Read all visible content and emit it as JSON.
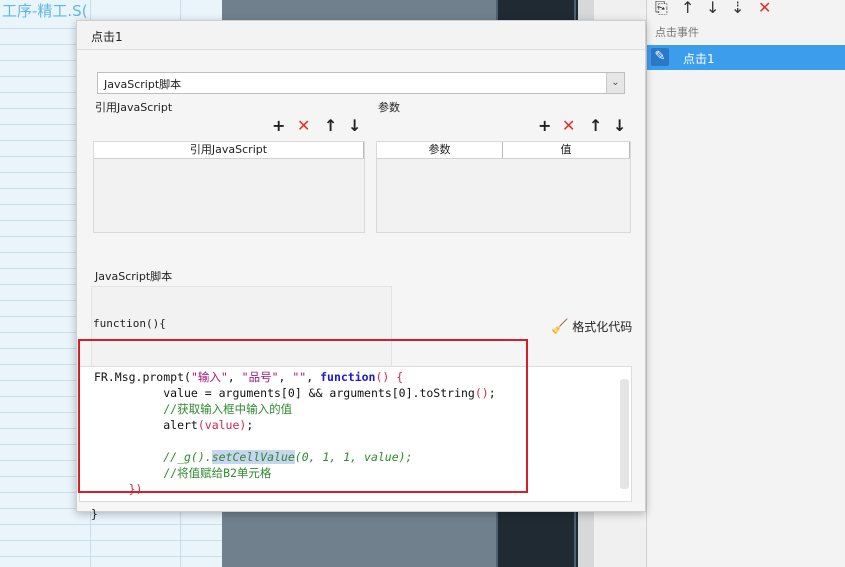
{
  "background": {
    "sheet_title": "工序-精工.S("
  },
  "right_panel": {
    "toolbar_icons": [
      "copy-icon",
      "arrow-up-icon",
      "arrow-down-icon",
      "sort-down-icon",
      "close-icon"
    ],
    "events_title": "点击事件",
    "events": [
      {
        "label": "点击1",
        "selected": true
      }
    ]
  },
  "dialog": {
    "title": "点击1",
    "type_select": {
      "value": "JavaScript脚本"
    },
    "ref_js": {
      "label": "引用JavaScript",
      "column": "引用JavaScript"
    },
    "params": {
      "label": "参数",
      "columns": [
        "参数",
        "值"
      ]
    },
    "script": {
      "label": "JavaScript脚本",
      "header": "function(){",
      "format_button": "格式化代码",
      "code": {
        "l1": [
          "FR.Msg.prompt(",
          "\"输入\"",
          ", ",
          "\"品号\"",
          ", ",
          "\"\"",
          ", ",
          "function",
          "() {"
        ],
        "l2": [
          "          value = arguments[",
          "0",
          "] && arguments[",
          "0",
          "].toString",
          "()",
          ";"
        ],
        "l3": "          //获取输入框中输入的值",
        "l4": [
          "          alert",
          "(value)",
          ";"
        ],
        "l6": [
          "          //_g().",
          "setCellValue",
          "(0, 1, 1, value);"
        ],
        "l7": "          //将值赋给B2单元格",
        "l8": "     })"
      },
      "footer": "}"
    }
  },
  "colors": {
    "accent": "#3d9ded",
    "annotation_box": "#d21f2a"
  }
}
